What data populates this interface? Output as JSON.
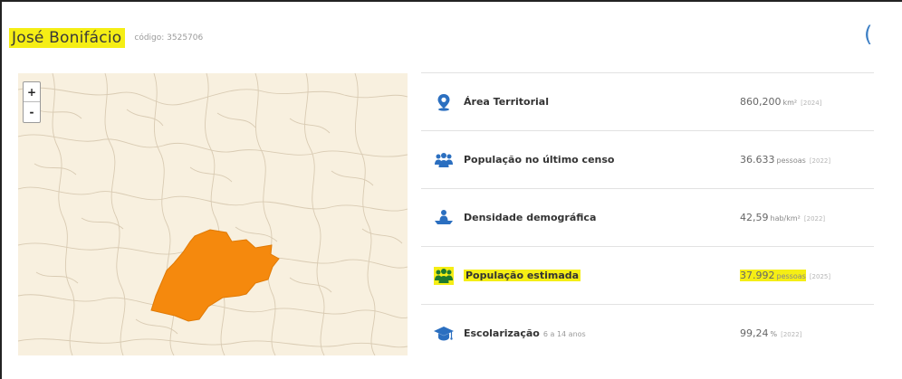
{
  "header": {
    "name": "José Bonifácio",
    "code": "código: 3525706",
    "side_glyph": "("
  },
  "map": {
    "zoom_in": "+",
    "zoom_out": "-",
    "highlight_color": "#f5890d",
    "background_color": "#f8f0df"
  },
  "stats": [
    {
      "icon": "location-pin-icon",
      "label": "Área Territorial",
      "sub": "",
      "value": "860,200",
      "unit": "km²",
      "year": "[2024]"
    },
    {
      "icon": "people-icon",
      "label": "População no último censo",
      "sub": "",
      "value": "36.633",
      "unit": "pessoas",
      "year": "[2022]"
    },
    {
      "icon": "density-icon",
      "label": "Densidade demográfica",
      "sub": "",
      "value": "42,59",
      "unit": "hab/km²",
      "year": "[2022]"
    },
    {
      "icon": "people-icon",
      "label": "População estimada",
      "sub": "",
      "value": "37.992",
      "unit": "pessoas",
      "year": "[2025]"
    },
    {
      "icon": "graduation-cap-icon",
      "label": "Escolarização",
      "sub": "6 a 14 anos",
      "value": "99,24",
      "unit": "%",
      "year": "[2022]"
    }
  ],
  "colors": {
    "highlight": "#f5ee15",
    "icon_blue": "#2b6fc0",
    "icon_green": "#1f7a2e"
  }
}
